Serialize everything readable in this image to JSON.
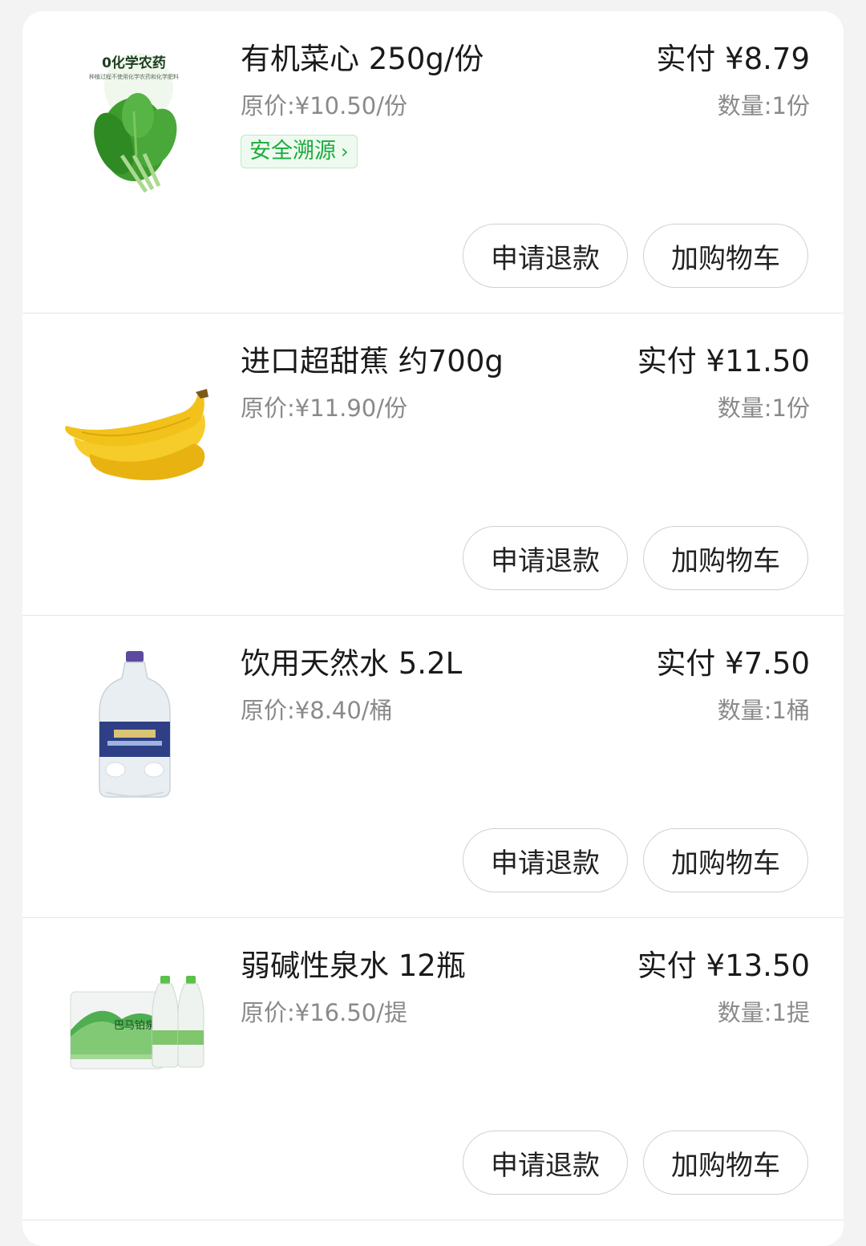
{
  "items": [
    {
      "name": "有机菜心 250g/份",
      "original_price": "原价:¥10.50/份",
      "paid": "实付 ¥8.79",
      "quantity": "数量:1份",
      "trace_label": "安全溯源",
      "image_caption": "0化学农药",
      "image_subcaption": "种植过程不使用化学农药和化学肥料",
      "refund_label": "申请退款",
      "cart_label": "加购物车"
    },
    {
      "name": "进口超甜蕉 约700g",
      "original_price": "原价:¥11.90/份",
      "paid": "实付 ¥11.50",
      "quantity": "数量:1份",
      "refund_label": "申请退款",
      "cart_label": "加购物车"
    },
    {
      "name": "饮用天然水 5.2L",
      "original_price": "原价:¥8.40/桶",
      "paid": "实付 ¥7.50",
      "quantity": "数量:1桶",
      "refund_label": "申请退款",
      "cart_label": "加购物车"
    },
    {
      "name": "弱碱性泉水 12瓶",
      "original_price": "原价:¥16.50/提",
      "paid": "实付 ¥13.50",
      "quantity": "数量:1提",
      "refund_label": "申请退款",
      "cart_label": "加购物车"
    }
  ],
  "colors": {
    "trace_green": "#1aad3b",
    "background": "#f3f3f3"
  },
  "icons": {
    "trace_chevron": "chevron-right-icon"
  }
}
